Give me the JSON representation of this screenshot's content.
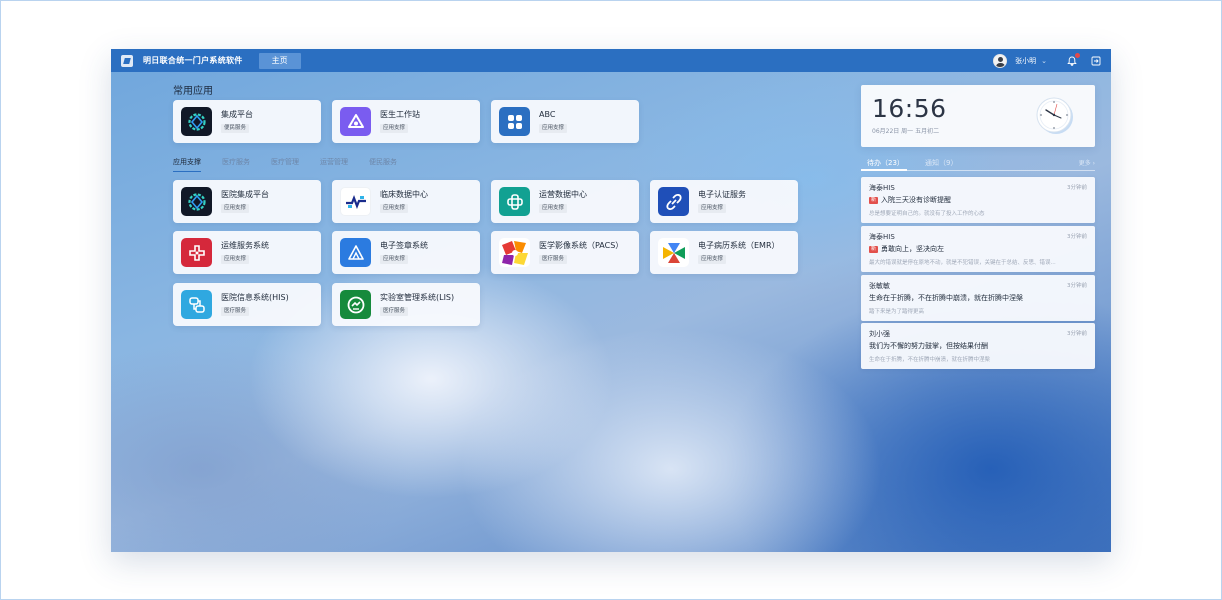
{
  "topbar": {
    "title": "明日联合统一门户系统软件",
    "home": "主页",
    "user": "张小明"
  },
  "common": {
    "title": "常用应用",
    "apps": [
      {
        "name": "集成平台",
        "tag": "便民服务",
        "icon": "integration-icon"
      },
      {
        "name": "医生工作站",
        "tag": "应用支撑",
        "icon": "doctor-station-icon"
      },
      {
        "name": "ABC",
        "tag": "应用支撑",
        "icon": "grid-icon"
      }
    ]
  },
  "tabs": [
    "应用支撑",
    "医疗服务",
    "医疗管理",
    "运营管理",
    "便民服务"
  ],
  "apps": [
    {
      "name": "医院集成平台",
      "tag": "应用支撑",
      "icon": "integration-icon"
    },
    {
      "name": "临床数据中心",
      "tag": "应用支撑",
      "icon": "clinical-data-icon"
    },
    {
      "name": "运营数据中心",
      "tag": "应用支撑",
      "icon": "operations-data-icon"
    },
    {
      "name": "电子认证服务",
      "tag": "应用支撑",
      "icon": "link-icon"
    },
    {
      "name": "运维服务系统",
      "tag": "应用支撑",
      "icon": "cross-icon"
    },
    {
      "name": "电子签章系统",
      "tag": "应用支撑",
      "icon": "triangle-icon"
    },
    {
      "name": "医学影像系统（PACS）",
      "tag": "医疗服务",
      "icon": "pacs-icon"
    },
    {
      "name": "电子病历系统（EMR）",
      "tag": "应用支撑",
      "icon": "emr-icon"
    },
    {
      "name": "医院信息系统(HIS)",
      "tag": "医疗服务",
      "icon": "his-icon"
    },
    {
      "name": "实验室管理系统(LIS)",
      "tag": "医疗服务",
      "icon": "lis-icon"
    }
  ],
  "clock": {
    "time": "16:56",
    "date": "06月22日 周一  五月初二"
  },
  "todo": {
    "tab_active": "待办（23）",
    "tab_other": "通知（9）",
    "more": "更多 ›",
    "items": [
      {
        "from": "海泰HIS",
        "ago": "3分钟前",
        "badge": "新",
        "title": "入院三天没有诊断提醒",
        "body": "总是想要证明自己的。就没有了投入工作的心态"
      },
      {
        "from": "海泰HIS",
        "ago": "3分钟前",
        "badge": "新",
        "title": "勇敢向上，坚决向左",
        "body": "最大的错误就是停在原地不动，就是不犯错误，关键在于总结、反思、错误..."
      },
      {
        "from": "张敏敏",
        "ago": "3分钟前",
        "badge": "",
        "title": "生命在于折腾，不在折腾中崩溃，就在折腾中涅槃",
        "body": "踏下来是为了踏得更高"
      },
      {
        "from": "刘小强",
        "ago": "3分钟前",
        "badge": "",
        "title": "我们为不懈的努力鼓掌，但按结果付酬",
        "body": "生命在于折腾，不在折腾中崩溃，就在折腾中涅槃"
      }
    ]
  },
  "colors": {
    "topbar": "#2b6fc1",
    "accent": "#2b6fc1",
    "badge": "#e2504c"
  }
}
